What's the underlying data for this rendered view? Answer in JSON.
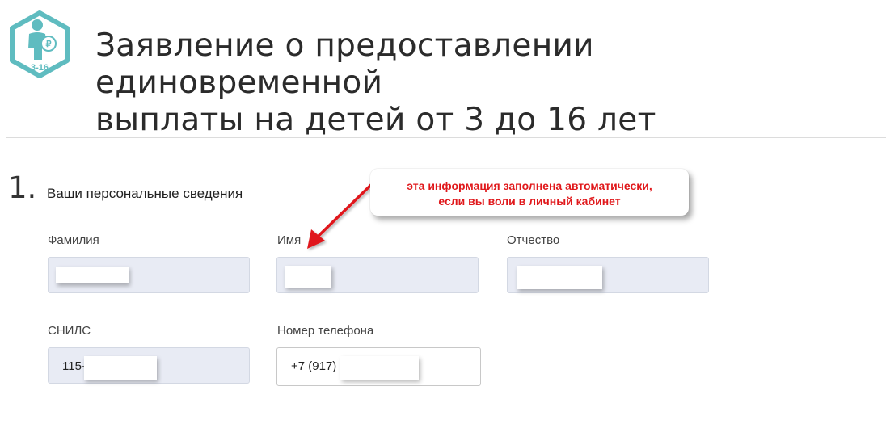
{
  "header": {
    "logo": {
      "icon": "child-ruble-badge-icon",
      "age_label": "3-16",
      "color": "#5fbcc0"
    },
    "title_line1": "Заявление о предоставлении единовременной",
    "title_line2": "выплаты на детей от 3 до 16 лет"
  },
  "section": {
    "number": "1.",
    "title": "Ваши персональные сведения"
  },
  "fields": {
    "last_name": {
      "label": "Фамилия",
      "value": ""
    },
    "first_name": {
      "label": "Имя",
      "value": ""
    },
    "patronymic": {
      "label": "Отчество",
      "value": ""
    },
    "snils": {
      "label": "СНИЛС",
      "value": "115-"
    },
    "phone": {
      "label": "Номер телефона",
      "value": "+7 (917)"
    }
  },
  "annotation": {
    "line1": "эта информация заполнена автоматически,",
    "line2": "если вы воли в личный кабинет",
    "color": "#e0181b"
  },
  "colors": {
    "readonly_field_bg": "#e8ebf4",
    "accent": "#5fbcc0"
  }
}
